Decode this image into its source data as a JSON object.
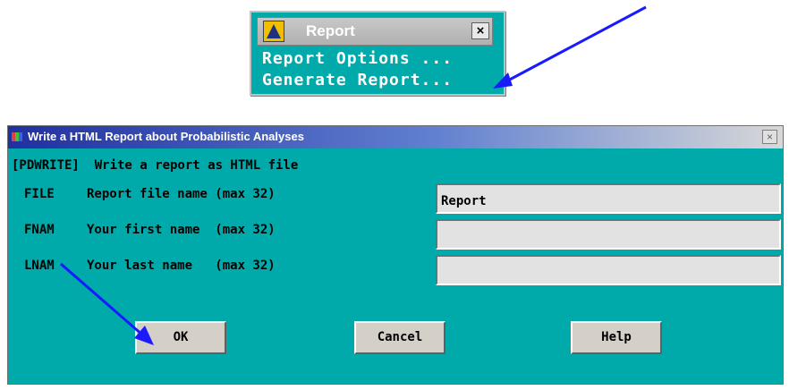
{
  "menu_window": {
    "title": "Report",
    "close_glyph": "×",
    "items": [
      {
        "label": "Report Options ..."
      },
      {
        "label": "Generate Report..."
      }
    ]
  },
  "dialog": {
    "title": "Write a HTML Report about Probabilistic Analyses",
    "close_glyph": "×",
    "header": "[PDWRITE]  Write a report as HTML file",
    "fields": [
      {
        "key": "FILE",
        "label": "Report file name (max 32)",
        "value": "Report"
      },
      {
        "key": "FNAM",
        "label": "Your first name  (max 32)",
        "value": ""
      },
      {
        "key": "LNAM",
        "label": "Your last name   (max 32)",
        "value": ""
      }
    ],
    "buttons": {
      "ok": "OK",
      "cancel": "Cancel",
      "help": "Help"
    }
  },
  "colors": {
    "panel_background": "#00aaaa",
    "annotation_arrow": "#1a1aff"
  },
  "icons": {
    "app_logo": "ansys-logo-icon",
    "close": "close-icon",
    "annotation": "pointer-arrow-icon"
  }
}
